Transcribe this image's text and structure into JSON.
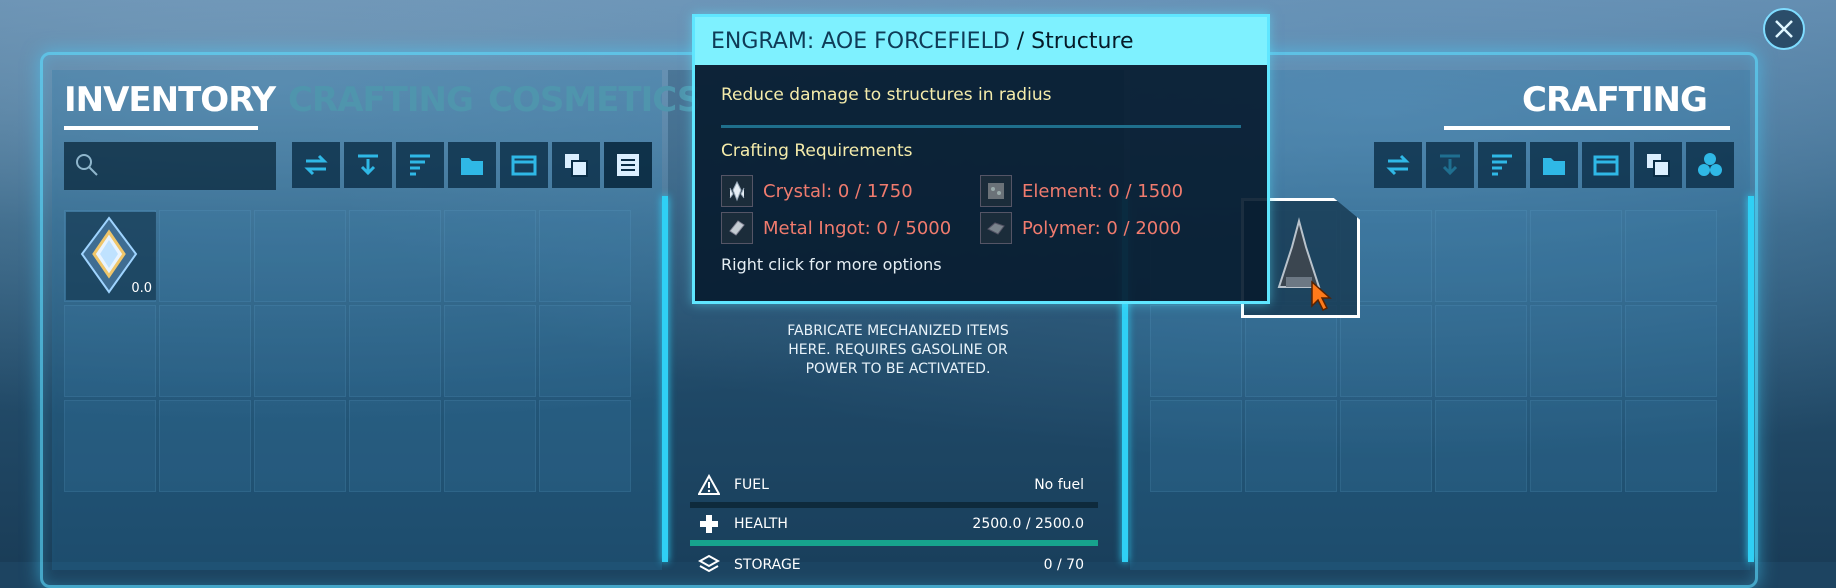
{
  "left_panel": {
    "tabs": [
      {
        "label": "INVENTORY",
        "active": true
      },
      {
        "label": "CRAFTING",
        "active": false
      },
      {
        "label": "COSMETICS",
        "active": false
      }
    ],
    "search": {
      "placeholder": ""
    },
    "toolbar_icons": [
      "transfer-icon",
      "drop-icon",
      "sort-icon",
      "new-folder-icon",
      "window-icon",
      "stack-icon",
      "list-icon"
    ],
    "item": {
      "name": "Element",
      "quantity": "0.0"
    }
  },
  "right_panel": {
    "tabs": [
      {
        "label": "CRAFTING",
        "active": true
      }
    ],
    "toolbar_icons": [
      "transfer-icon",
      "drop-icon",
      "sort-icon",
      "new-folder-icon",
      "window-icon",
      "stack-icon",
      "hex-icon"
    ]
  },
  "middle_panel": {
    "description": "FABRICATE MECHANIZED ITEMS HERE. REQUIRES GASOLINE OR POWER TO BE ACTIVATED.",
    "stats": [
      {
        "label": "FUEL",
        "value": "No fuel",
        "icon": "warning-icon"
      },
      {
        "label": "HEALTH",
        "value": "2500.0 / 2500.0",
        "icon": "plus-icon",
        "fill": 1.0
      },
      {
        "label": "STORAGE",
        "value": "0 / 70",
        "icon": "storage-icon"
      }
    ]
  },
  "tooltip": {
    "title_prefix": "ENGRAM: AOE FORCEFIELD",
    "title_suffix": " / Structure",
    "summary": "Reduce damage to structures in radius",
    "requirements_title": "Crafting Requirements",
    "requirements": [
      {
        "label": "Crystal: 0 / 1750",
        "icon": "crystal-icon"
      },
      {
        "label": "Element: 0 / 1500",
        "icon": "element-icon"
      },
      {
        "label": "Metal Ingot: 0 / 5000",
        "icon": "ingot-icon"
      },
      {
        "label": "Polymer: 0 / 2000",
        "icon": "polymer-icon"
      }
    ],
    "hint": "Right click for more options",
    "header_color": "#7ef1ff",
    "requirement_color": "#f07b6e"
  },
  "colors": {
    "frame": "#2fd0f5",
    "health_bar": "#17a38d"
  }
}
